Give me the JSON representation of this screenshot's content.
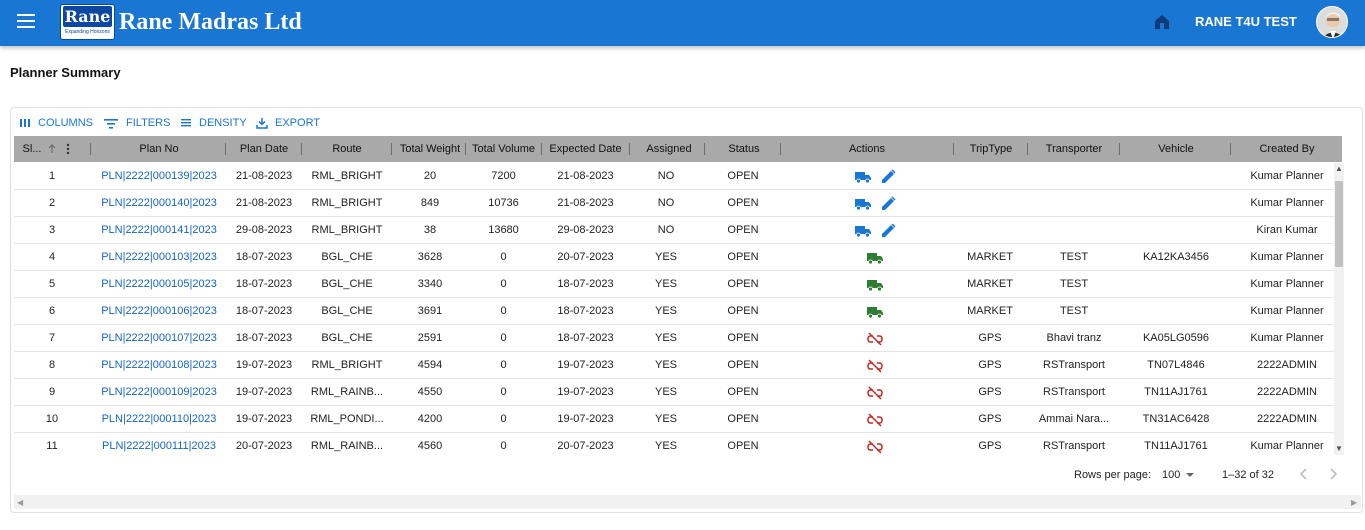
{
  "app": {
    "title": "Rane Madras Ltd",
    "logo_word": "Rane",
    "logo_tagline": "Expanding Horizons",
    "user": "RANE T4U TEST"
  },
  "page": {
    "title": "Planner Summary"
  },
  "toolbar": {
    "columns": "COLUMNS",
    "filters": "FILTERS",
    "density": "DENSITY",
    "export": "EXPORT"
  },
  "columns": [
    "Sl...",
    "Plan No",
    "Plan Date",
    "Route",
    "Total Weight",
    "Total Volume",
    "Expected Date",
    "Assigned",
    "Status",
    "Actions",
    "TripType",
    "Transporter",
    "Vehicle",
    "Created By"
  ],
  "rows": [
    {
      "sl": "1",
      "plan": "PLN|2222|000139|2023",
      "date": "21-08-2023",
      "route": "RML_BRIGHT",
      "weight": "20",
      "volume": "7200",
      "expected": "21-08-2023",
      "assigned": "NO",
      "status": "OPEN",
      "action": "truck-blue",
      "trip": "",
      "transporter": "",
      "vehicle": "",
      "created": "Kumar Planner"
    },
    {
      "sl": "2",
      "plan": "PLN|2222|000140|2023",
      "date": "21-08-2023",
      "route": "RML_BRIGHT",
      "weight": "849",
      "volume": "10736",
      "expected": "21-08-2023",
      "assigned": "NO",
      "status": "OPEN",
      "action": "truck-blue",
      "trip": "",
      "transporter": "",
      "vehicle": "",
      "created": "Kumar Planner"
    },
    {
      "sl": "3",
      "plan": "PLN|2222|000141|2023",
      "date": "29-08-2023",
      "route": "RML_BRIGHT",
      "weight": "38",
      "volume": "13680",
      "expected": "29-08-2023",
      "assigned": "NO",
      "status": "OPEN",
      "action": "truck-blue",
      "trip": "",
      "transporter": "",
      "vehicle": "",
      "created": "Kiran Kumar"
    },
    {
      "sl": "4",
      "plan": "PLN|2222|000103|2023",
      "date": "18-07-2023",
      "route": "BGL_CHE",
      "weight": "3628",
      "volume": "0",
      "expected": "20-07-2023",
      "assigned": "YES",
      "status": "OPEN",
      "action": "truck-green",
      "trip": "MARKET",
      "transporter": "TEST",
      "vehicle": "KA12KA3456",
      "created": "Kumar Planner"
    },
    {
      "sl": "5",
      "plan": "PLN|2222|000105|2023",
      "date": "18-07-2023",
      "route": "BGL_CHE",
      "weight": "3340",
      "volume": "0",
      "expected": "18-07-2023",
      "assigned": "YES",
      "status": "OPEN",
      "action": "truck-green",
      "trip": "MARKET",
      "transporter": "TEST",
      "vehicle": "",
      "created": "Kumar Planner"
    },
    {
      "sl": "6",
      "plan": "PLN|2222|000106|2023",
      "date": "18-07-2023",
      "route": "BGL_CHE",
      "weight": "3691",
      "volume": "0",
      "expected": "18-07-2023",
      "assigned": "YES",
      "status": "OPEN",
      "action": "truck-green",
      "trip": "MARKET",
      "transporter": "TEST",
      "vehicle": "",
      "created": "Kumar Planner"
    },
    {
      "sl": "7",
      "plan": "PLN|2222|000107|2023",
      "date": "18-07-2023",
      "route": "BGL_CHE",
      "weight": "2591",
      "volume": "0",
      "expected": "18-07-2023",
      "assigned": "YES",
      "status": "OPEN",
      "action": "link-off",
      "trip": "GPS",
      "transporter": "Bhavi tranz",
      "vehicle": "KA05LG0596",
      "created": "Kumar Planner"
    },
    {
      "sl": "8",
      "plan": "PLN|2222|000108|2023",
      "date": "19-07-2023",
      "route": "RML_BRIGHT",
      "weight": "4594",
      "volume": "0",
      "expected": "19-07-2023",
      "assigned": "YES",
      "status": "OPEN",
      "action": "link-off",
      "trip": "GPS",
      "transporter": "RSTransport",
      "vehicle": "TN07L4846",
      "created": "2222ADMIN"
    },
    {
      "sl": "9",
      "plan": "PLN|2222|000109|2023",
      "date": "19-07-2023",
      "route": "RML_RAINB...",
      "weight": "4550",
      "volume": "0",
      "expected": "19-07-2023",
      "assigned": "YES",
      "status": "OPEN",
      "action": "link-off",
      "trip": "GPS",
      "transporter": "RSTransport",
      "vehicle": "TN11AJ1761",
      "created": "2222ADMIN"
    },
    {
      "sl": "10",
      "plan": "PLN|2222|000110|2023",
      "date": "19-07-2023",
      "route": "RML_PONDI...",
      "weight": "4200",
      "volume": "0",
      "expected": "19-07-2023",
      "assigned": "YES",
      "status": "OPEN",
      "action": "link-off",
      "trip": "GPS",
      "transporter": "Ammai Nara...",
      "vehicle": "TN31AC6428",
      "created": "2222ADMIN"
    },
    {
      "sl": "11",
      "plan": "PLN|2222|000111|2023",
      "date": "20-07-2023",
      "route": "RML_RAINB...",
      "weight": "4560",
      "volume": "0",
      "expected": "20-07-2023",
      "assigned": "YES",
      "status": "OPEN",
      "action": "link-off",
      "trip": "GPS",
      "transporter": "RSTransport",
      "vehicle": "TN11AJ1761",
      "created": "Kumar Planner"
    }
  ],
  "pagination": {
    "rows_per_page_label": "Rows per page:",
    "rows_per_page": "100",
    "range": "1–32 of 32"
  },
  "icons": {
    "menu": "menu-icon",
    "home": "home-icon",
    "columns": "columns-icon",
    "filters": "filter-icon",
    "density": "density-icon",
    "export": "export-icon",
    "truck_blue": "truck-icon",
    "edit": "edit-icon",
    "truck_green": "truck-icon",
    "link_off": "link-off-icon"
  },
  "colors": {
    "appbar": "#1976d2",
    "link": "#1565c0",
    "truck_blue": "#1976d2",
    "truck_green": "#2e7d32",
    "link_off": "#c62828",
    "header_bg": "#a9a9a9"
  }
}
